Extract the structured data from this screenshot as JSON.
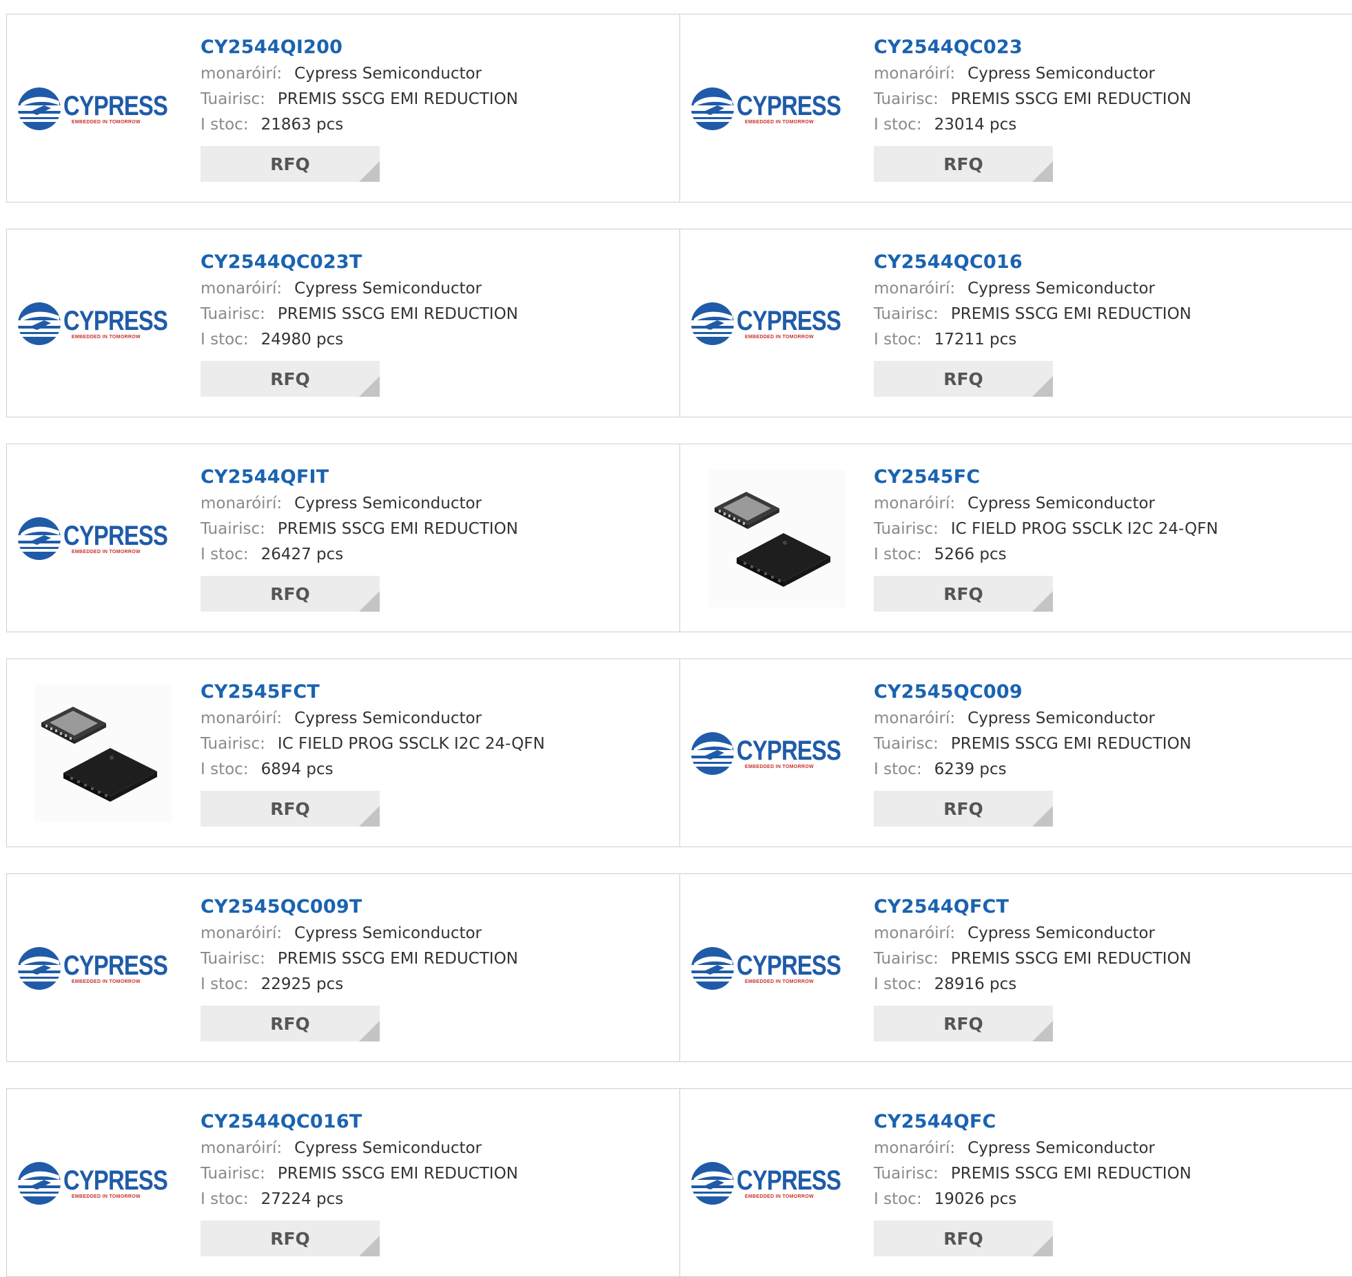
{
  "labels": {
    "manufacturer": "monaróirí:",
    "description": "Tuairisc:",
    "stock": "I stoc:",
    "rfq": "RFQ"
  },
  "logo": {
    "word": "CYPRESS",
    "tagline": "EMBEDDED IN TOMORROW"
  },
  "colors": {
    "link": "#1a63b0",
    "brand_blue": "#1f5ba8",
    "brand_red": "#c9302c"
  },
  "rows": [
    [
      {
        "pn": "CY2544QI200",
        "manufacturer": "Cypress Semiconductor",
        "description": "PREMIS SSCG EMI REDUCTION",
        "stock": "21863 pcs",
        "image": "cypress-logo"
      },
      {
        "pn": "CY2544QC023",
        "manufacturer": "Cypress Semiconductor",
        "description": "PREMIS SSCG EMI REDUCTION",
        "stock": "23014 pcs",
        "image": "cypress-logo"
      }
    ],
    [
      {
        "pn": "CY2544QC023T",
        "manufacturer": "Cypress Semiconductor",
        "description": "PREMIS SSCG EMI REDUCTION",
        "stock": "24980 pcs",
        "image": "cypress-logo"
      },
      {
        "pn": "CY2544QC016",
        "manufacturer": "Cypress Semiconductor",
        "description": "PREMIS SSCG EMI REDUCTION",
        "stock": "17211 pcs",
        "image": "cypress-logo"
      }
    ],
    [
      {
        "pn": "CY2544QFIT",
        "manufacturer": "Cypress Semiconductor",
        "description": "PREMIS SSCG EMI REDUCTION",
        "stock": "26427 pcs",
        "image": "cypress-logo"
      },
      {
        "pn": "CY2545FC",
        "manufacturer": "Cypress Semiconductor",
        "description": "IC FIELD PROG SSCLK I2C 24-QFN",
        "stock": "5266 pcs",
        "image": "qfn-chip"
      }
    ],
    [
      {
        "pn": "CY2545FCT",
        "manufacturer": "Cypress Semiconductor",
        "description": "IC FIELD PROG SSCLK I2C 24-QFN",
        "stock": "6894 pcs",
        "image": "qfn-chip"
      },
      {
        "pn": "CY2545QC009",
        "manufacturer": "Cypress Semiconductor",
        "description": "PREMIS SSCG EMI REDUCTION",
        "stock": "6239 pcs",
        "image": "cypress-logo"
      }
    ],
    [
      {
        "pn": "CY2545QC009T",
        "manufacturer": "Cypress Semiconductor",
        "description": "PREMIS SSCG EMI REDUCTION",
        "stock": "22925 pcs",
        "image": "cypress-logo"
      },
      {
        "pn": "CY2544QFCT",
        "manufacturer": "Cypress Semiconductor",
        "description": "PREMIS SSCG EMI REDUCTION",
        "stock": "28916 pcs",
        "image": "cypress-logo"
      }
    ],
    [
      {
        "pn": "CY2544QC016T",
        "manufacturer": "Cypress Semiconductor",
        "description": "PREMIS SSCG EMI REDUCTION",
        "stock": "27224 pcs",
        "image": "cypress-logo"
      },
      {
        "pn": "CY2544QFC",
        "manufacturer": "Cypress Semiconductor",
        "description": "PREMIS SSCG EMI REDUCTION",
        "stock": "19026 pcs",
        "image": "cypress-logo"
      }
    ]
  ]
}
